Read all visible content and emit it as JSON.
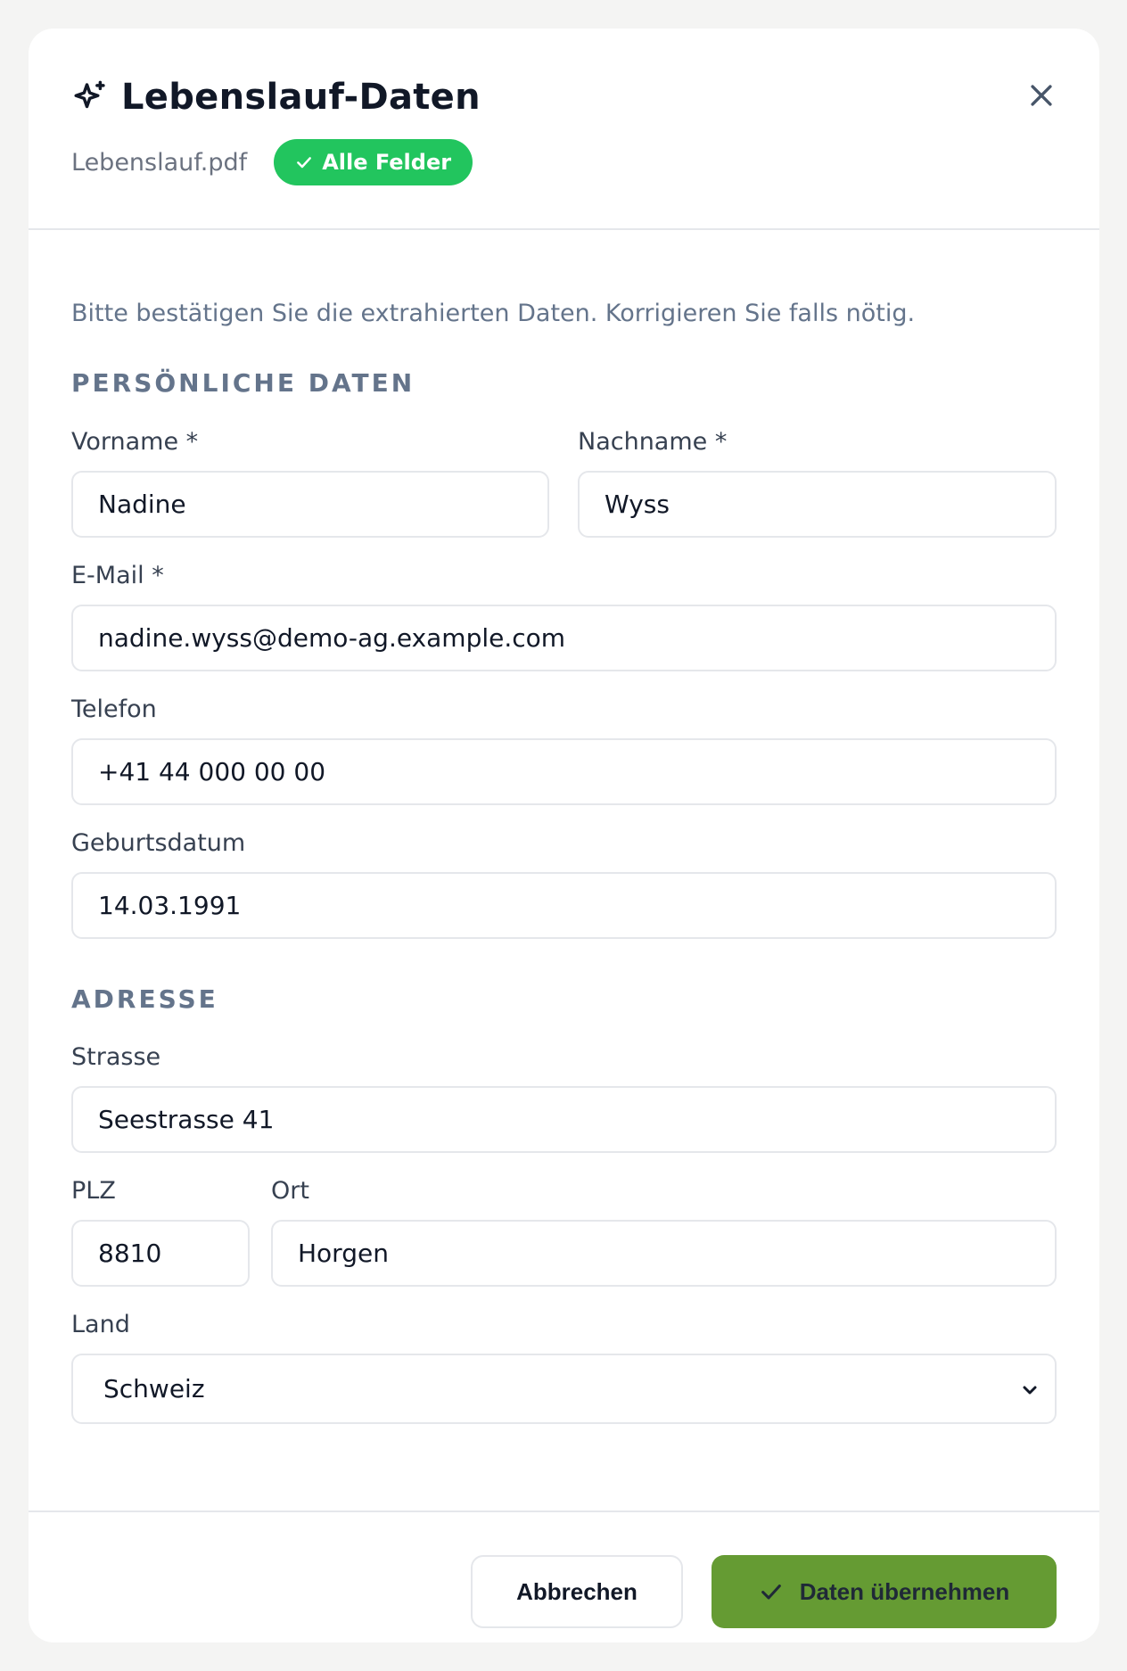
{
  "dialog": {
    "title": "Lebenslauf-Daten",
    "filename": "Lebenslauf.pdf",
    "badge": "Alle Felder",
    "intro": "Bitte bestätigen Sie die extrahierten Daten. Korrigieren Sie falls nötig."
  },
  "personal": {
    "section_title": "PERSÖNLICHE DATEN",
    "firstname": {
      "label": "Vorname *",
      "value": "Nadine"
    },
    "lastname": {
      "label": "Nachname *",
      "value": "Wyss"
    },
    "email": {
      "label": "E-Mail *",
      "value": "nadine.wyss@demo-ag.example.com"
    },
    "phone": {
      "label": "Telefon",
      "value": "+41 44 000 00 00"
    },
    "birthdate": {
      "label": "Geburtsdatum",
      "value": "14.03.1991"
    }
  },
  "address": {
    "section_title": "ADRESSE",
    "street": {
      "label": "Strasse",
      "value": "Seestrasse 41"
    },
    "zip": {
      "label": "PLZ",
      "value": "8810"
    },
    "city": {
      "label": "Ort",
      "value": "Horgen"
    },
    "country": {
      "label": "Land",
      "value": "Schweiz"
    }
  },
  "actions": {
    "cancel": "Abbrechen",
    "submit": "Daten übernehmen"
  },
  "colors": {
    "badge": "#22c55e",
    "submit": "#659b33"
  },
  "icons": {
    "title": "sparkle-icon",
    "close": "close-icon",
    "badge": "check-icon",
    "select": "chevron-down-icon",
    "submit": "check-icon"
  }
}
